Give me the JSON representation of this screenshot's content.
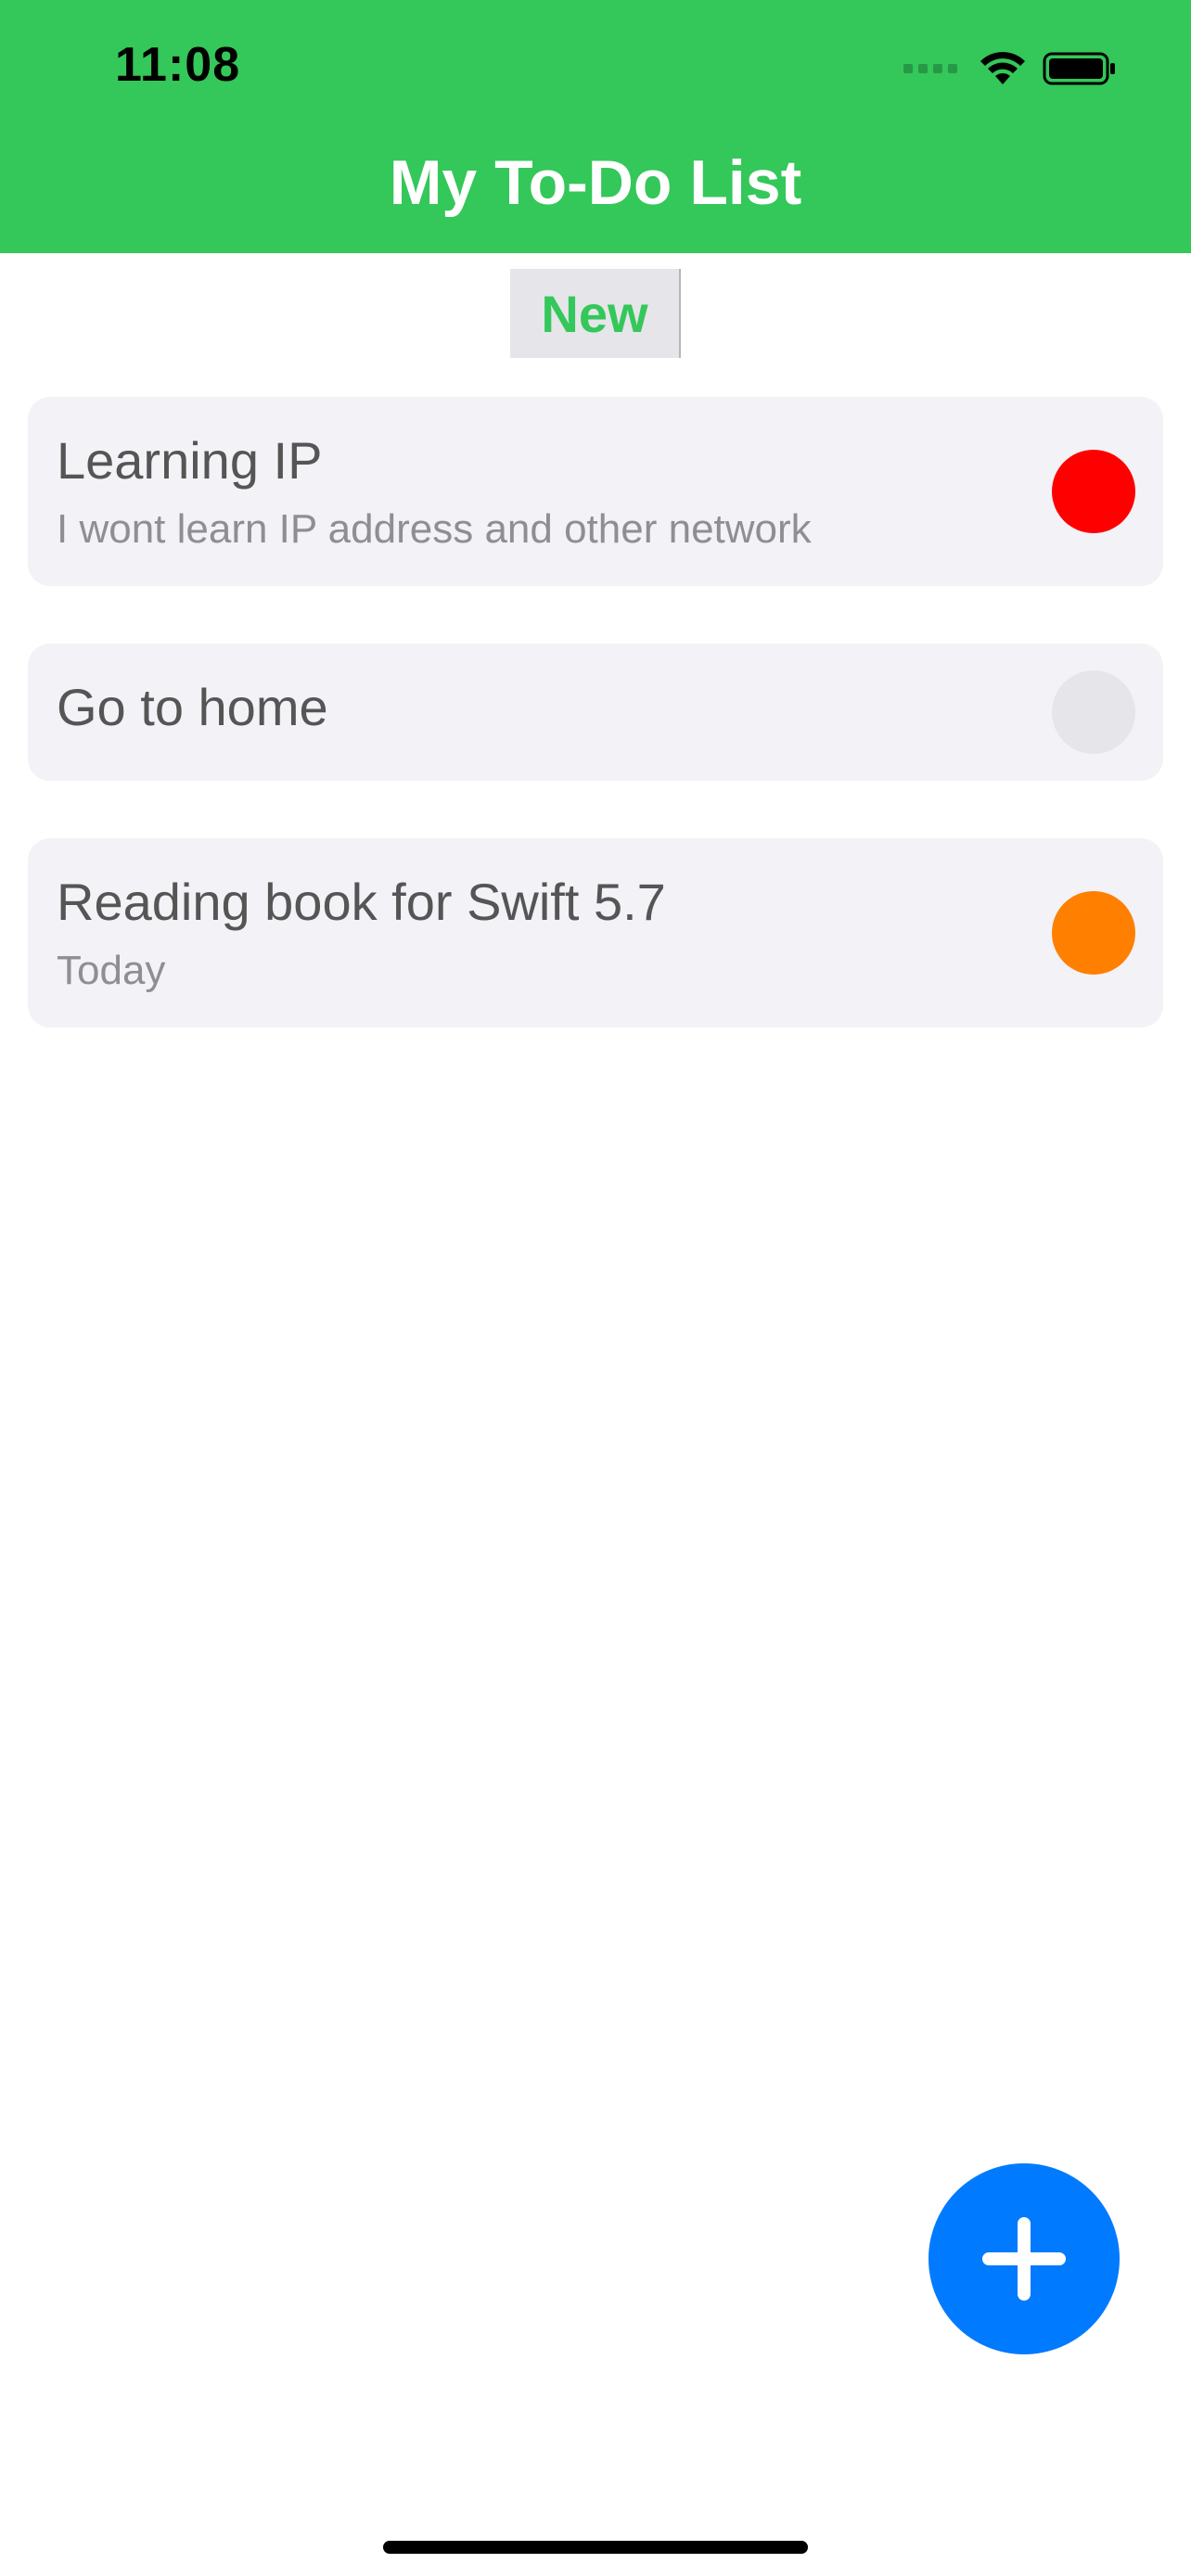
{
  "status_bar": {
    "time": "11:08",
    "icons": [
      "signal-icon",
      "wifi-icon",
      "battery-icon"
    ]
  },
  "header": {
    "title": "My To-Do List",
    "background_color": "#34c759"
  },
  "segment": {
    "label": "New",
    "color": "#34c759"
  },
  "todos": [
    {
      "title": "Learning IP",
      "subtitle": "I wont learn IP address and other network",
      "status_color": "#ff0000"
    },
    {
      "title": "Go to home",
      "subtitle": "",
      "status_color": "#e5e5ea"
    },
    {
      "title": "Reading book for Swift 5.7",
      "subtitle": "Today",
      "status_color": "#ff7f00"
    }
  ],
  "fab": {
    "icon": "plus-icon",
    "color": "#007aff"
  }
}
